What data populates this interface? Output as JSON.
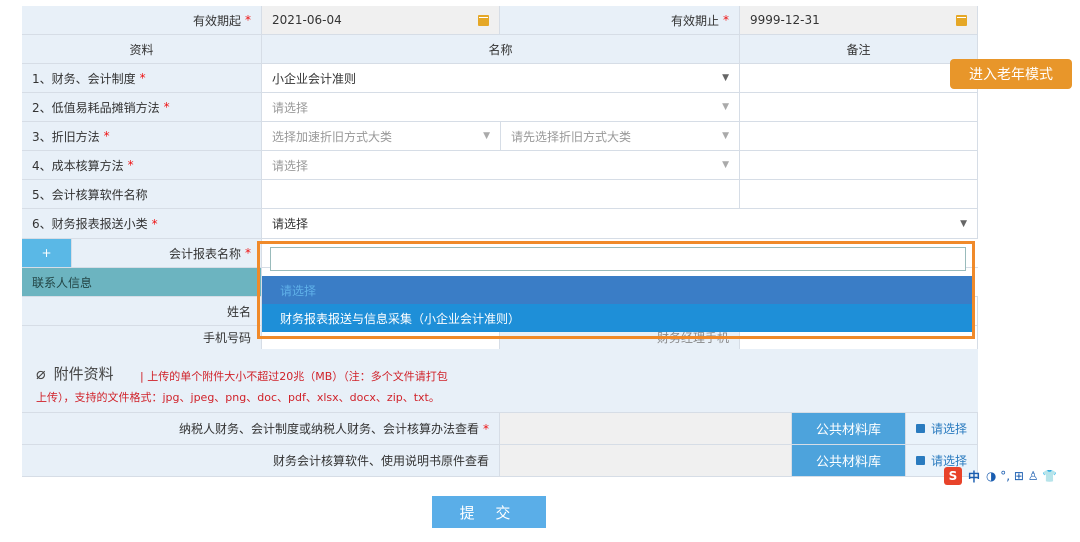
{
  "header": {
    "valid_from_label": "有效期起",
    "valid_from_value": "2021-06-04",
    "valid_to_label": "有效期止",
    "valid_to_value": "9999-12-31",
    "required_mark": "*"
  },
  "table_header": {
    "col_material": "资料",
    "col_name": "名称",
    "col_remark": "备注"
  },
  "rows": [
    {
      "label": "1、财务、会计制度",
      "value": "小企业会计准则"
    },
    {
      "label": "2、低值易耗品摊销方法",
      "placeholder": "请选择"
    },
    {
      "label": "3、折旧方法",
      "placeholder_a": "选择加速折旧方式大类",
      "placeholder_b": "请先选择折旧方式大类"
    },
    {
      "label": "4、成本核算方法",
      "placeholder": "请选择"
    },
    {
      "label": "5、会计核算软件名称"
    },
    {
      "label": "6、财务报表报送小类",
      "value": "请选择"
    }
  ],
  "report": {
    "plus_label": "+",
    "name_label": "会计报表名称"
  },
  "contact": {
    "section_label": "联系人信息",
    "name_label": "姓名",
    "phone_label": "手机号码",
    "hidden_label": "财务经理手机"
  },
  "dropdown": {
    "option_please": "请选择",
    "option_selected": "财务报表报送与信息采集（小企业会计准则）"
  },
  "attachments": {
    "title": "附件资料",
    "note_line1": "| 上传的单个附件大小不超过20兆（MB）（注：多个文件请打包",
    "note_line2": "上传），支持的文件格式：jpg、jpeg、png、doc、pdf、xlsx、docx、zip、txt。",
    "items": [
      {
        "label": "纳税人财务、会计制度或纳税人财务、会计核算办法查看",
        "required": true,
        "lib_label": "公共材料库",
        "pick_label": "请选择"
      },
      {
        "label": "财务会计核算软件、使用说明书原件查看",
        "required": false,
        "lib_label": "公共材料库",
        "pick_label": "请选择"
      }
    ]
  },
  "elder_mode_button": "进入老年模式",
  "submit_button": "提 交",
  "ime": {
    "logo": "S",
    "lang": "中",
    "icons": "◑ °, ⊞ ♙ 👕"
  },
  "colors": {
    "accent_orange": "#f08a2a",
    "primary_blue": "#1e8fd8",
    "required_red": "#e11111"
  }
}
